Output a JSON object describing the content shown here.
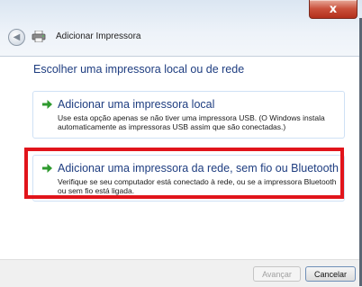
{
  "window": {
    "title": "Adicionar Impressora",
    "close_label": "x"
  },
  "main": {
    "heading": "Escolher uma impressora local ou de rede",
    "options": [
      {
        "title": "Adicionar uma impressora local",
        "description": "Use esta opção apenas se não tiver uma impressora USB. (O Windows instala automaticamente as impressoras USB assim que são conectadas.)"
      },
      {
        "title": "Adicionar uma impressora da rede, sem fio ou Bluetooth",
        "description": "Verifique se seu computador está conectado à rede, ou se a impressora Bluetooth ou sem fio está ligada."
      }
    ]
  },
  "footer": {
    "next_label": "Avançar",
    "cancel_label": "Cancelar"
  },
  "colors": {
    "highlight": "#e1141b",
    "link_blue": "#1e3d80",
    "arrow_green": "#2e9a2e"
  },
  "icons": {
    "back": "back-arrow-icon",
    "printer": "printer-icon",
    "option": "green-arrow-icon"
  }
}
